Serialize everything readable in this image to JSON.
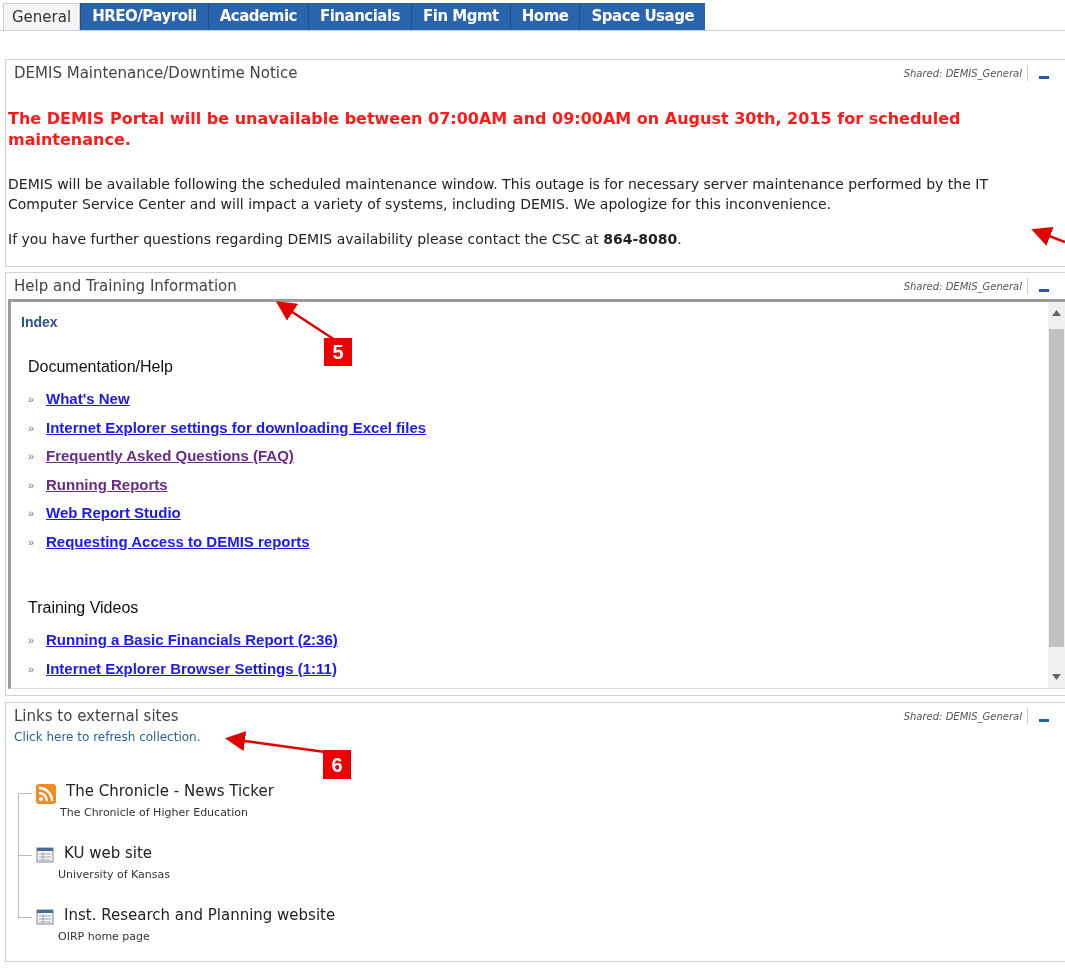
{
  "tabs": [
    {
      "label": "General",
      "selected": true
    },
    {
      "label": "HREO/Payroll",
      "selected": false
    },
    {
      "label": "Academic",
      "selected": false
    },
    {
      "label": "Financials",
      "selected": false
    },
    {
      "label": "Fin Mgmt",
      "selected": false
    },
    {
      "label": "Home",
      "selected": false
    },
    {
      "label": "Space Usage",
      "selected": false
    }
  ],
  "notice": {
    "title": "DEMIS Maintenance/Downtime Notice",
    "shared": "Shared: DEMIS_General",
    "alert": "The DEMIS Portal will be unavailable between 07:00AM and 09:00AM on August 30th, 2015 for scheduled maintenance.",
    "body": "DEMIS will be available following the scheduled maintenance window. This outage is for necessary server maintenance performed by the IT Computer Service Center and will impact a variety of systems, including DEMIS. We apologize for this inconvenience.",
    "contact": "If you have further questions regarding DEMIS availability please contact the CSC at **864-8080**."
  },
  "help": {
    "title": "Help and Training Information",
    "shared": "Shared: DEMIS_General",
    "index": "Index",
    "sections": [
      {
        "heading": "Documentation/Help",
        "links": [
          {
            "text": "What's New",
            "visited": false
          },
          {
            "text": "Internet Explorer settings for downloading Excel files",
            "visited": false
          },
          {
            "text": "Frequently Asked Questions (FAQ)",
            "visited": true
          },
          {
            "text": "Running Reports",
            "visited": true
          },
          {
            "text": "Web Report Studio",
            "visited": false
          },
          {
            "text": "Requesting Access to DEMIS reports",
            "visited": false
          }
        ]
      },
      {
        "heading": "Training Videos",
        "links": [
          {
            "text": "Running a Basic Financials Report (2:36)",
            "visited": false
          },
          {
            "text": "Internet Explorer Browser Settings (1:11)",
            "visited": false
          }
        ]
      }
    ],
    "bullet": "»"
  },
  "external": {
    "title": "Links to external sites",
    "shared": "Shared: DEMIS_General",
    "refresh": "Click here to refresh collection.",
    "items": [
      {
        "kind": "feed",
        "title": "The Chronicle - News Ticker",
        "subtitle": "The Chronicle of Higher Education"
      },
      {
        "kind": "page",
        "title": "KU web site",
        "subtitle": "University of Kansas"
      },
      {
        "kind": "page",
        "title": "Inst. Research and Planning website",
        "subtitle": "OIRP home page"
      }
    ]
  },
  "annotations": [
    {
      "label": "5"
    },
    {
      "label": "6"
    }
  ]
}
